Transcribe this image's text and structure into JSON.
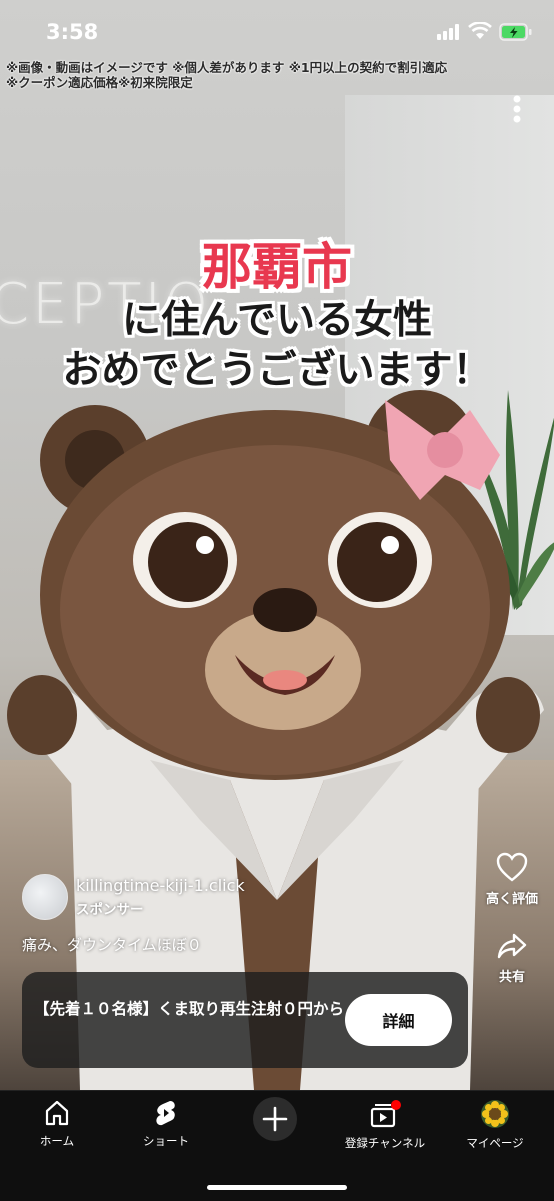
{
  "status_bar": {
    "time": "3:58"
  },
  "disclaimer": {
    "line1": "※画像・動画はイメージです ※個人差があります ※1円以上の契約で割引適応",
    "line2": "※クーポン適応価格※初来院限定"
  },
  "video": {
    "background_sign": "CEPTIO",
    "headline_line1": "那覇市",
    "headline_line2": "に住んでいる女性",
    "headline_line3": "おめでとうございます！"
  },
  "actions": {
    "like_label": "高く評価",
    "share_label": "共有"
  },
  "ad": {
    "domain": "killingtime-kiji-1.click",
    "sponsor_label": "スポンサー",
    "caption": "痛み、ダウンタイムほぼ０",
    "cta_text": "【先着１０名様】くま取り再生注射０円から",
    "cta_button": "詳細"
  },
  "nav": {
    "home": "ホーム",
    "shorts": "ショート",
    "subscriptions": "登録チャンネル",
    "you": "マイページ"
  },
  "colors": {
    "headline_red": "#e8384f",
    "nav_bg": "#0f0f0f",
    "notification_dot": "#ff0000"
  }
}
